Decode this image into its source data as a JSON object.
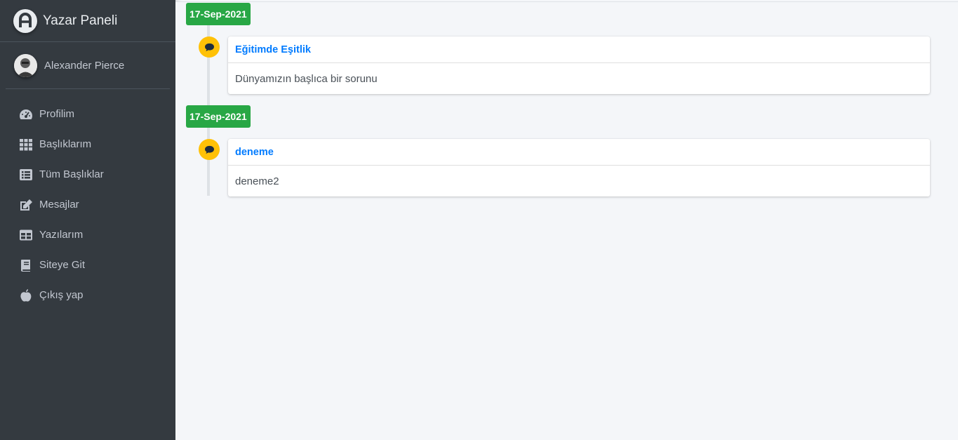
{
  "brand": {
    "title": "Yazar Paneli",
    "logo_icon": "brand-logo-icon"
  },
  "user": {
    "name": "Alexander Pierce"
  },
  "sidebar": {
    "items": [
      {
        "label": "Profilim",
        "icon": "tachometer-icon"
      },
      {
        "label": "Başlıklarım",
        "icon": "grid-icon"
      },
      {
        "label": "Tüm Başlıklar",
        "icon": "list-icon"
      },
      {
        "label": "Mesajlar",
        "icon": "edit-icon"
      },
      {
        "label": "Yazılarım",
        "icon": "table-icon"
      },
      {
        "label": "Siteye Git",
        "icon": "book-icon"
      },
      {
        "label": "Çıkış yap",
        "icon": "apple-icon"
      }
    ]
  },
  "timeline": {
    "entries": [
      {
        "date": "17-Sep-2021",
        "title": "Eğitimde Eşitlik",
        "body": "Dünyamızın başlıca bir sorunu",
        "icon": "comment-icon"
      },
      {
        "date": "17-Sep-2021",
        "title": "deneme",
        "body": "deneme2",
        "icon": "comment-icon"
      }
    ]
  },
  "colors": {
    "sidebar_bg": "#343a40",
    "date_badge": "#28a745",
    "icon_bg": "#ffc107",
    "link": "#007bff"
  }
}
